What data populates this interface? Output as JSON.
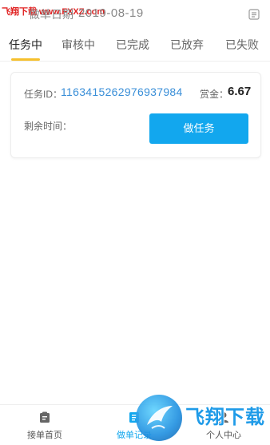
{
  "header": {
    "watermark": "飞翔下载 www.FXXZ.com",
    "date_label": "做单日期",
    "date_value": "2019-08-19",
    "doc_icon": "document-icon"
  },
  "tabs": [
    {
      "label": "任务中",
      "active": true
    },
    {
      "label": "审核中",
      "active": false
    },
    {
      "label": "已完成",
      "active": false
    },
    {
      "label": "已放弃",
      "active": false
    },
    {
      "label": "已失败",
      "active": false
    }
  ],
  "card": {
    "task_id_label": "任务ID：",
    "task_id_value": "1163415262976937984",
    "reward_label": "赏金：",
    "reward_value": "6.67",
    "remain_label": "剩余时间：",
    "button_label": "做任务"
  },
  "bottom_nav": [
    {
      "label": "接单首页",
      "icon": "home-task-icon",
      "active": false
    },
    {
      "label": "做单记录",
      "icon": "record-icon",
      "active": true
    },
    {
      "label": "个人中心",
      "icon": "user-icon",
      "active": false
    }
  ],
  "logo_watermark": {
    "text": "飞翔下载"
  },
  "colors": {
    "accent": "#12a7ee",
    "tab_indicator": "#f6c02d",
    "task_id": "#3a8fd8"
  }
}
